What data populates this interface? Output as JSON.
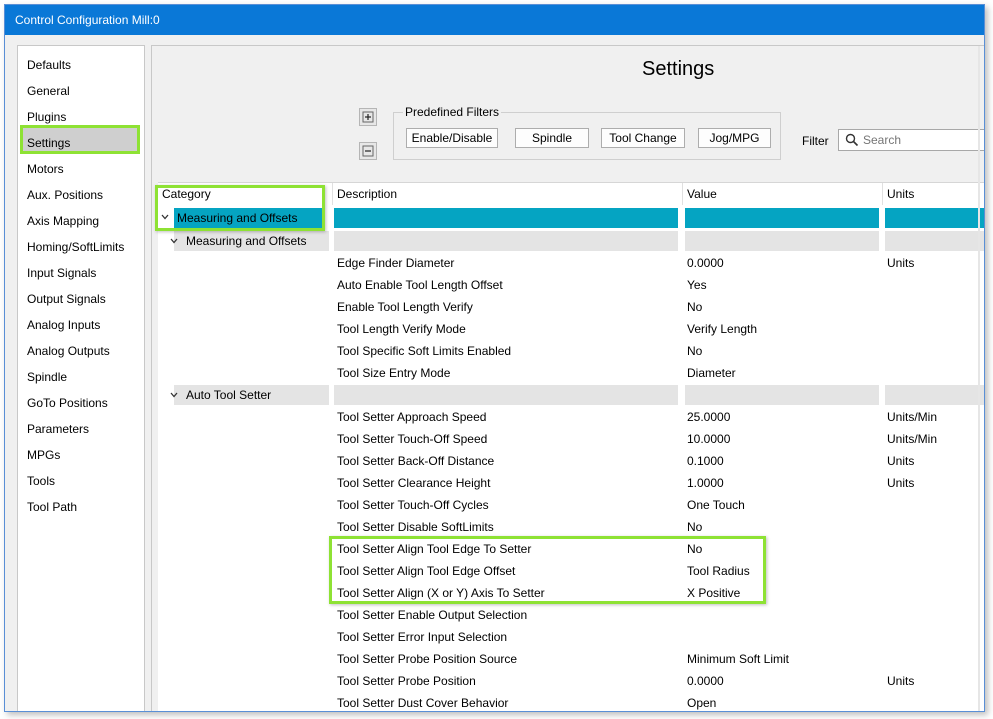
{
  "window": {
    "title": "Control Configuration Mill:0"
  },
  "sidebar": {
    "selected_index": 3,
    "items": [
      "Defaults",
      "General",
      "Plugins",
      "Settings",
      "Motors",
      "Aux. Positions",
      "Axis Mapping",
      "Homing/SoftLimits",
      "Input Signals",
      "Output Signals",
      "Analog Inputs",
      "Analog Outputs",
      "Spindle",
      "GoTo Positions",
      "Parameters",
      "MPGs",
      "Tools",
      "Tool Path"
    ]
  },
  "header": {
    "title": "Settings",
    "expand_icon": "expand-all-icon",
    "collapse_icon": "collapse-all-icon"
  },
  "filters": {
    "group_label": "Predefined Filters",
    "buttons": [
      "Enable/Disable",
      "Spindle",
      "Tool Change",
      "Jog/MPG"
    ],
    "filter_label": "Filter",
    "search_placeholder": "Search"
  },
  "grid": {
    "columns": [
      "Category",
      "Description",
      "Value",
      "Units"
    ],
    "top_category": "Measuring and Offsets",
    "groups": [
      {
        "name": "Measuring and Offsets",
        "rows": [
          [
            "Edge Finder Diameter",
            "0.0000",
            "Units"
          ],
          [
            "Auto Enable Tool Length Offset",
            "Yes",
            ""
          ],
          [
            "Enable Tool Length Verify",
            "No",
            ""
          ],
          [
            "Tool Length Verify Mode",
            "Verify Length",
            ""
          ],
          [
            "Tool Specific Soft Limits Enabled",
            "No",
            ""
          ],
          [
            "Tool Size Entry Mode",
            "Diameter",
            ""
          ]
        ]
      },
      {
        "name": "Auto Tool Setter",
        "rows": [
          [
            "Tool Setter Approach Speed",
            "25.0000",
            "Units/Min"
          ],
          [
            "Tool Setter Touch-Off Speed",
            "10.0000",
            "Units/Min"
          ],
          [
            "Tool Setter Back-Off Distance",
            "0.1000",
            "Units"
          ],
          [
            "Tool Setter Clearance Height",
            "1.0000",
            "Units"
          ],
          [
            "Tool Setter Touch-Off Cycles",
            "One Touch",
            ""
          ],
          [
            "Tool Setter Disable SoftLimits",
            "No",
            ""
          ],
          [
            "Tool Setter Align Tool Edge To Setter",
            "No",
            ""
          ],
          [
            "Tool Setter Align Tool Edge Offset",
            "Tool Radius",
            ""
          ],
          [
            "Tool Setter Align (X or Y) Axis To Setter",
            "X Positive",
            ""
          ],
          [
            "Tool Setter Enable Output Selection",
            "",
            ""
          ],
          [
            "Tool Setter Error Input Selection",
            "",
            ""
          ],
          [
            "Tool Setter Probe Position Source",
            "Minimum Soft Limit",
            ""
          ],
          [
            "Tool Setter Probe Position",
            "0.0000",
            "Units"
          ],
          [
            "Tool Setter Dust Cover Behavior",
            "Open",
            ""
          ]
        ]
      }
    ]
  },
  "colors": {
    "titlebar": "#0a78d7",
    "category_bar": "#05a4c2",
    "highlight": "#8ee234"
  }
}
